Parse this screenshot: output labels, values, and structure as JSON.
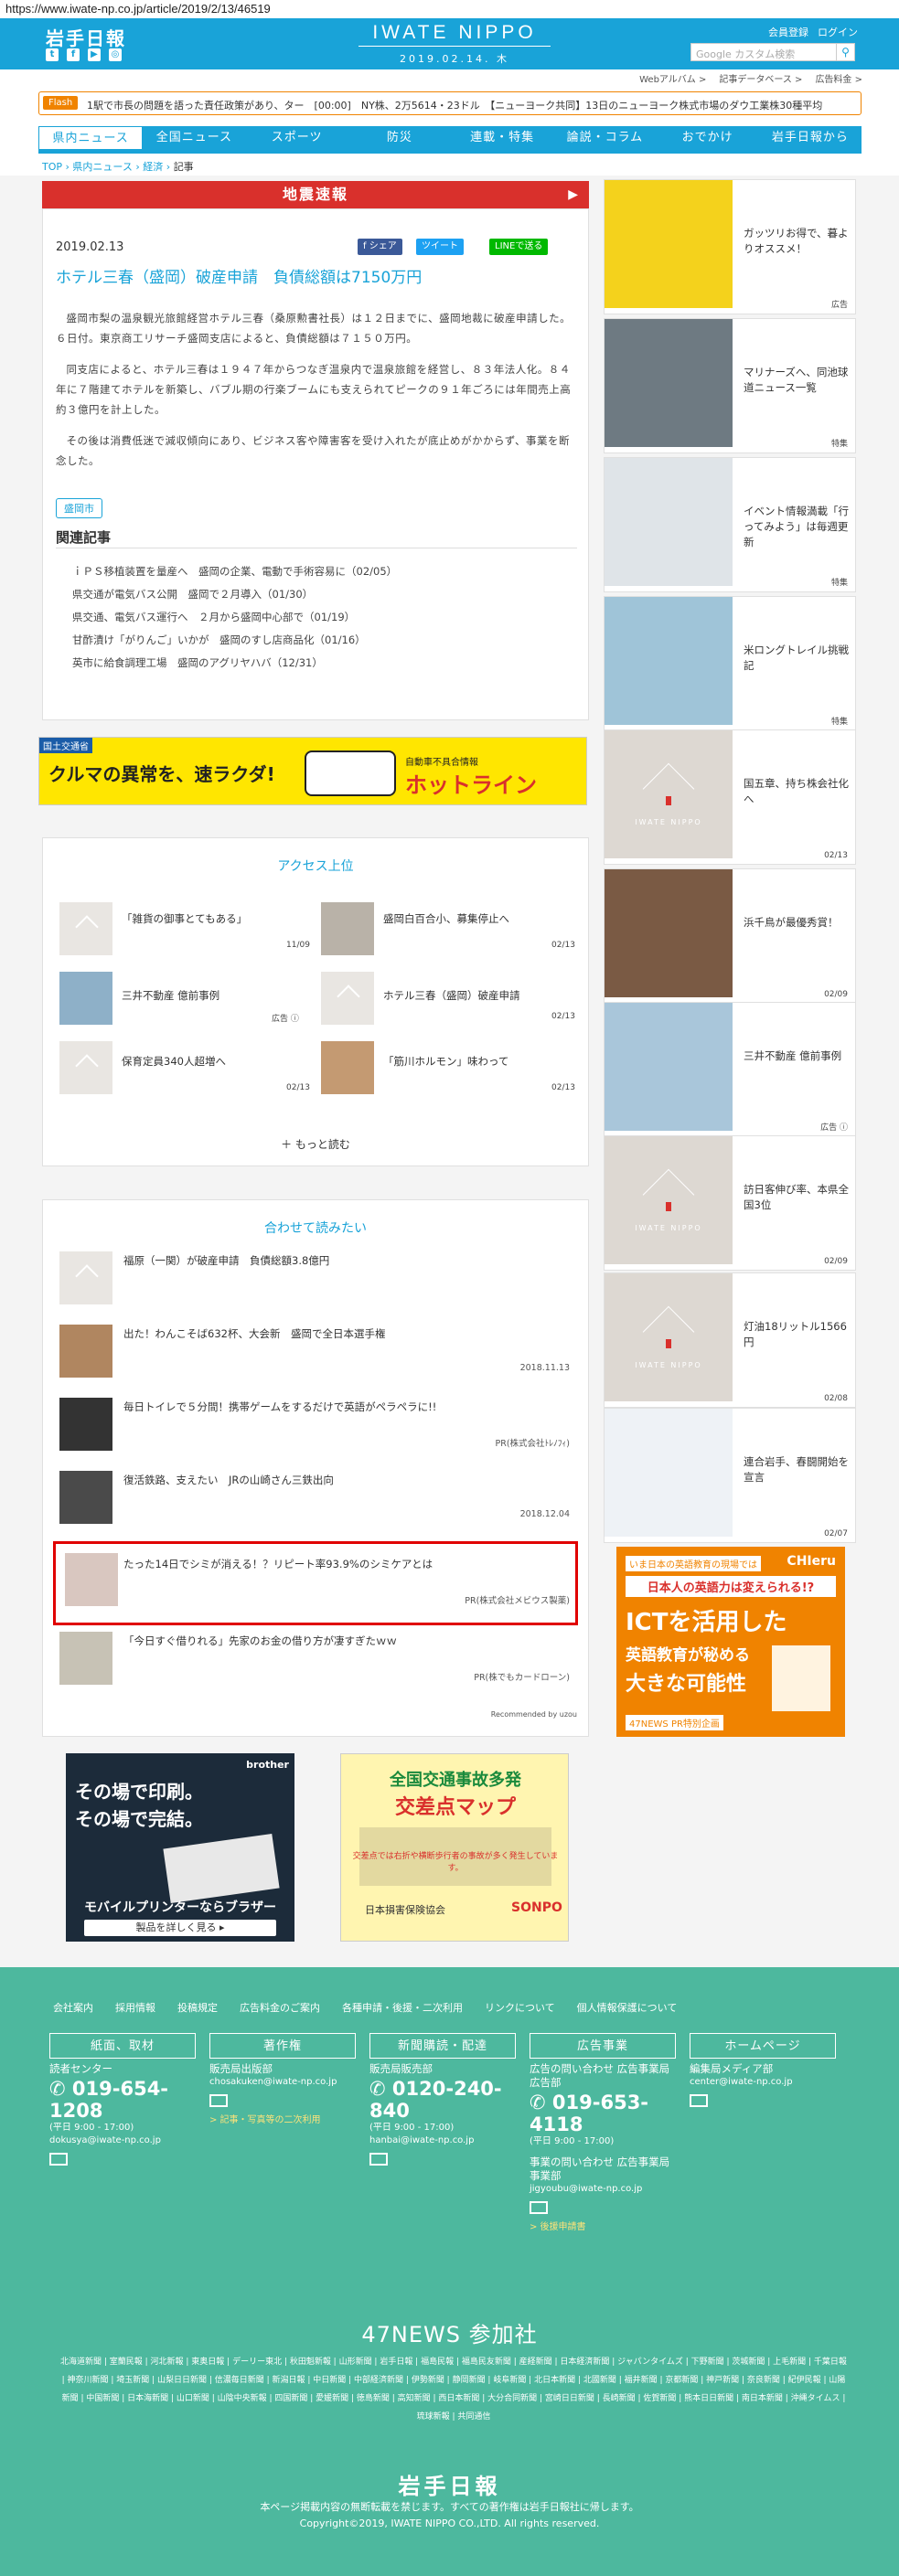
{
  "url": "https://www.iwate-np.co.jp/article/2019/2/13/46519",
  "header": {
    "logo_jp": "岩手日報",
    "brand": "IWATE NIPPO",
    "date": "2019.02.14. 木",
    "links": [
      "会員登録",
      "ログイン"
    ],
    "search_placeholder": "Google カスタム検索",
    "sublinks": [
      "Webアルバム >",
      "記事データベース >",
      "広告料金 >"
    ]
  },
  "flash": {
    "label": "Flash",
    "text": "1駅で市長の問題を語った責任政策があり、ター　[00:00]　NY株、2万5614・23ドル　【ニューヨーク共同】13日のニューヨーク株式市場のダウ工業株30種平均"
  },
  "nav": [
    "県内ニュース",
    "全国ニュース",
    "スポーツ",
    "防災",
    "連載・特集",
    "論説・コラム",
    "おでかけ",
    "岩手日報から"
  ],
  "breadcrumb": {
    "items": [
      "TOP",
      "県内ニュース",
      "経済"
    ],
    "current": "記事"
  },
  "article": {
    "flash_header": "地震速報",
    "date": "2019.02.13",
    "share_fb": "f シェア",
    "share_tw": "ツイート",
    "share_line": "LINEで送る",
    "title": "ホテル三春（盛岡）破産申請　負債総額は7150万円",
    "paragraphs": [
      "盛岡市梨の温泉観光旅館経営ホテル三春（桑原勲書社長）は１２日までに、盛岡地裁に破産申請した。６日付。東京商工リサーチ盛岡支店によると、負債総額は７１５０万円。",
      "同支店によると、ホテル三春は１９４７年からつなぎ温泉内で温泉旅館を経営し、８３年法人化。８４年に７階建てホテルを新築し、バブル期の行楽ブームにも支えられてピークの９１年ごろには年間売上高約３億円を計上した。",
      "その後は消費低迷で減収傾向にあり、ビジネス客や障害客を受け入れたが底止めがかからず、事業を断念した。"
    ],
    "tag": "盛岡市",
    "related_heading": "関連記事",
    "related": [
      "ｉＰＳ移植装置を量産へ　盛岡の企業、電動で手術容易に（02/05）",
      "県交通が電気バス公開　盛岡で２月導入（01/30）",
      "県交通、電気バス運行へ　２月から盛岡中心部で（01/19）",
      "甘酢漬け「がりんご」いかが　盛岡のすし店商品化（01/16）",
      "英市に給食調理工場　盛岡のアグリヤハバ（12/31）"
    ]
  },
  "banner": {
    "top": "国土交通省",
    "main": "クルマの異常を、速ラクダ!",
    "sub": "自動車不具合情報",
    "big": "ホットライン"
  },
  "access": {
    "heading": "アクセス上位",
    "items": [
      {
        "title": "「雑貨の御事とてもある」",
        "date": "11/09"
      },
      {
        "title": "盛岡白百合小、募集停止へ",
        "date": "02/13"
      },
      {
        "title": "三井不動産 億前事例",
        "date": "広告 ⓘ"
      },
      {
        "title": "ホテル三春（盛岡）破産申請",
        "date": "02/13"
      },
      {
        "title": "保育定員340人超増へ",
        "date": "02/13"
      },
      {
        "title": "「筋川ホルモン」味わって",
        "date": "02/13"
      }
    ],
    "more": "＋ もっと読む"
  },
  "recommend": {
    "heading": "合わせて読みたい",
    "items": [
      {
        "title": "福原（一関）が破産申請　負債総額3.8億円",
        "meta": ""
      },
      {
        "title": "出た！わんこそば632杯、大会新　盛岡で全日本選手権",
        "meta": "2018.11.13"
      },
      {
        "title": "毎日トイレで５分間！携帯ゲームをするだけで英語がペラペラに!!",
        "meta": "PR(株式会社ﾄﾚﾉﾌｨ)"
      },
      {
        "title": "復活鉄路、支えたい　JRの山崎さん三鉄出向",
        "meta": "2018.12.04"
      },
      {
        "title": "たった14日でシミが消える！？リピート率93.9%のシミケアとは",
        "meta": "PR(株式会社メビウス製薬)"
      },
      {
        "title": "「今日すぐ借りれる」先家のお金の借り方が凄すぎたｗｗ",
        "meta": "PR(株でもカードローン)"
      }
    ],
    "powered": "Recommended by  uzou"
  },
  "sidebar": [
    {
      "text": "ガッツリお得で、暮よりオススメ！",
      "date": "広告"
    },
    {
      "text": "マリナーズへ、同池球道ニュース一覧",
      "date": "特集"
    },
    {
      "text": "イベント情報満載「行ってみよう」は毎週更新",
      "date": "特集"
    },
    {
      "text": "米ロングトレイル挑戦記",
      "date": "特集"
    },
    {
      "text": "国五章、持ち株会社化へ",
      "date": "02/13"
    },
    {
      "text": "浜千鳥が最優秀賞！",
      "date": "02/09"
    },
    {
      "text": "三井不動産 億前事例",
      "date": "広告 ⓘ"
    },
    {
      "text": "訪日客伸び率、本県全国3位",
      "date": "02/09"
    },
    {
      "text": "灯油18リットル1566円",
      "date": "02/08"
    },
    {
      "text": "連合岩手、春闘開始を宣言",
      "date": "02/07"
    }
  ],
  "ads": {
    "chieru_top": "いま日本の英語教育の現場では",
    "chieru_brand": "CHIeru",
    "chieru_q": "日本人の英語力は変えられる!?",
    "chieru_big": "ICTを活用した",
    "chieru_mid": "英語教育が秘める",
    "chieru_end": "大きな可能性",
    "chieru_foot": "47NEWS PR特別企画",
    "brother_1": "その場で印刷。",
    "brother_2": "その場で完結。",
    "brother_3": "モバイルプリンターならブラザー",
    "brother_4": "製品を詳しく見る ▸",
    "brother_logo": "brother",
    "sonpo_1": "全国交通事故多発",
    "sonpo_2": "交差点マップ",
    "sonpo_3": "交差点では右折や横断歩行者の事故が多く発生しています。",
    "sonpo_org": "日本損害保険協会",
    "sonpo_logo": "SONPO"
  },
  "footer": {
    "links": [
      "会社案内",
      "採用情報",
      "投稿規定",
      "広告料金のご案内",
      "各種申請・後援・二次利用",
      "リンクについて",
      "個人情報保護について"
    ],
    "cols": [
      {
        "h": "紙面、取材",
        "l1": "読者センター",
        "tel": "019-654-1208",
        "hours": "(平日 9:00 - 17:00)",
        "mail": "dokusya@iwate-np.co.jp",
        "extra": ""
      },
      {
        "h": "著作権",
        "l1": "販売局出版部",
        "tel": "",
        "hours": "",
        "mail": "chosakuken@iwate-np.co.jp",
        "extra": "> 記事・写真等の二次利用"
      },
      {
        "h": "新聞購読・配達",
        "l1": "販売局販売部",
        "tel": "0120-240-840",
        "hours": "(平日 9:00 - 17:00)",
        "mail": "hanbai@iwate-np.co.jp",
        "extra": ""
      },
      {
        "h": "広告事業",
        "l1": "広告の問い合わせ 広告事業局広告部",
        "tel": "019-653-4118",
        "hours": "(平日 9:00 - 17:00)",
        "mail": "jigyoubu@iwate-np.co.jp",
        "extra": "> 後援申請書",
        "l2": "事業の問い合わせ 広告事業局事業部"
      },
      {
        "h": "ホームページ",
        "l1": "編集局メディア部",
        "tel": "",
        "hours": "",
        "mail": "center@iwate-np.co.jp",
        "extra": ""
      }
    ],
    "news47": "47NEWS 参加社",
    "papers": "北海道新聞 | 室蘭民報 | 河北新報 | 東奥日報 | デーリー東北 | 秋田魁新報 | 山形新聞 | 岩手日報 | 福島民報 | 福島民友新聞 | 産経新聞 | 日本経済新聞 | ジャパンタイムズ | 下野新聞 | 茨城新聞 | 上毛新聞 | 千葉日報 | 神奈川新聞 | 埼玉新聞 | 山梨日日新聞 | 信濃毎日新聞 | 新潟日報 | 中日新聞 | 中部経済新聞 | 伊勢新聞 | 静岡新聞 | 岐阜新聞 | 北日本新聞 | 北國新聞 | 福井新聞 | 京都新聞 | 神戸新聞 | 奈良新聞 | 紀伊民報 | 山陽新聞 | 中国新聞 | 日本海新聞 | 山口新聞 | 山陰中央新報 | 四国新聞 | 愛媛新聞 | 徳島新聞 | 高知新聞 | 西日本新聞 | 大分合同新聞 | 宮崎日日新聞 | 長崎新聞 | 佐賀新聞 | 熊本日日新聞 | 南日本新聞 | 沖縄タイムス | 琉球新報 | 共同通信",
    "logo": "岩手日報",
    "notice": "本ページ掲載内容の無断転載を禁じます。すべての著作権は岩手日報社に帰します。",
    "copyright": "Copyright©2019, IWATE NIPPO CO.,LTD. All rights reserved."
  }
}
